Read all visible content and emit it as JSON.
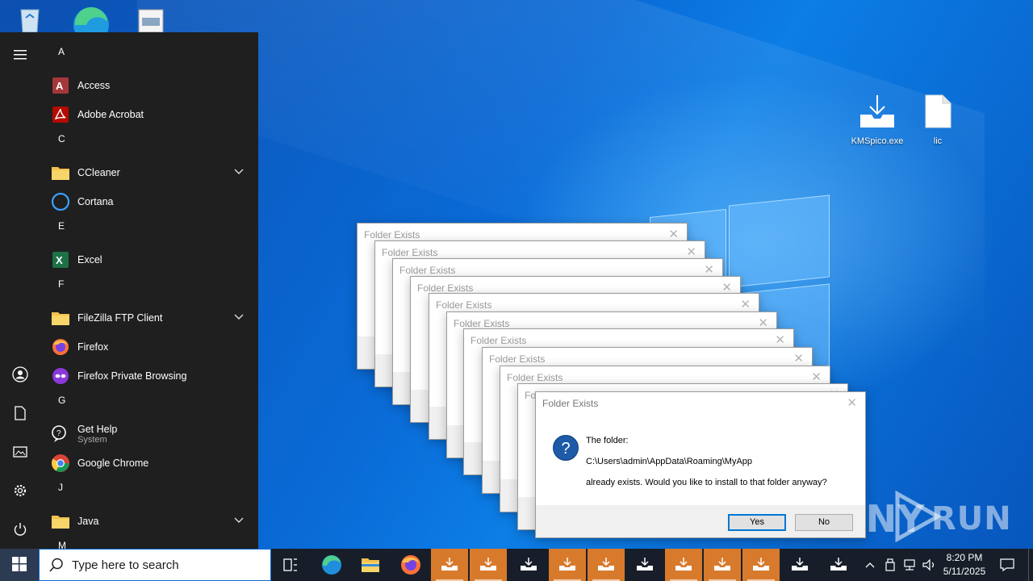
{
  "desktop": {
    "top_icons": [
      "recycle-bin-icon",
      "edge-icon",
      "document-icon"
    ],
    "icons": [
      {
        "label": "KMSpico.exe",
        "icon": "installer-icon"
      },
      {
        "label": "lic",
        "icon": "blank-file-icon"
      }
    ]
  },
  "start_menu": {
    "rail": [
      "hamburger-menu-icon",
      "user-icon",
      "documents-icon",
      "pictures-icon",
      "settings-icon",
      "power-icon"
    ],
    "letters": {
      "a": "A",
      "c": "C",
      "e": "E",
      "f": "F",
      "g": "G",
      "j": "J",
      "m": "M"
    },
    "apps": {
      "access": "Access",
      "acrobat": "Adobe Acrobat",
      "ccleaner": "CCleaner",
      "cortana": "Cortana",
      "excel": "Excel",
      "filezilla": "FileZilla FTP Client",
      "firefox": "Firefox",
      "firefox_private": "Firefox Private Browsing",
      "get_help": "Get Help",
      "get_help_sub": "System",
      "chrome": "Google Chrome",
      "java": "Java"
    }
  },
  "dialogs": {
    "title": "Folder Exists",
    "stack_count": 10,
    "message_line1": "The folder:",
    "message_path": "C:\\Users\\admin\\AppData\\Roaming\\MyApp",
    "message_line3": "already exists. Would you like to install to that folder anyway?",
    "yes_label": "Yes",
    "no_label": "No",
    "close_glyph": "✕"
  },
  "taskbar": {
    "search_placeholder": "Type here to search",
    "clock_time": "8:20 PM",
    "clock_date": "5/11/2025",
    "pinned": [
      "task-view-icon",
      "edge-icon",
      "file-explorer-icon",
      "firefox-icon"
    ],
    "running_task_count": 11,
    "tray": [
      "chevron-up-icon",
      "usb-icon",
      "network-icon",
      "volume-icon"
    ]
  },
  "watermark": {
    "text": "ANY RUN"
  },
  "colors": {
    "start_bg": "#1f1f1f",
    "taskbar_bg": "#171e2a",
    "accent": "#0078d7",
    "task_highlight": "#d87a2c"
  }
}
